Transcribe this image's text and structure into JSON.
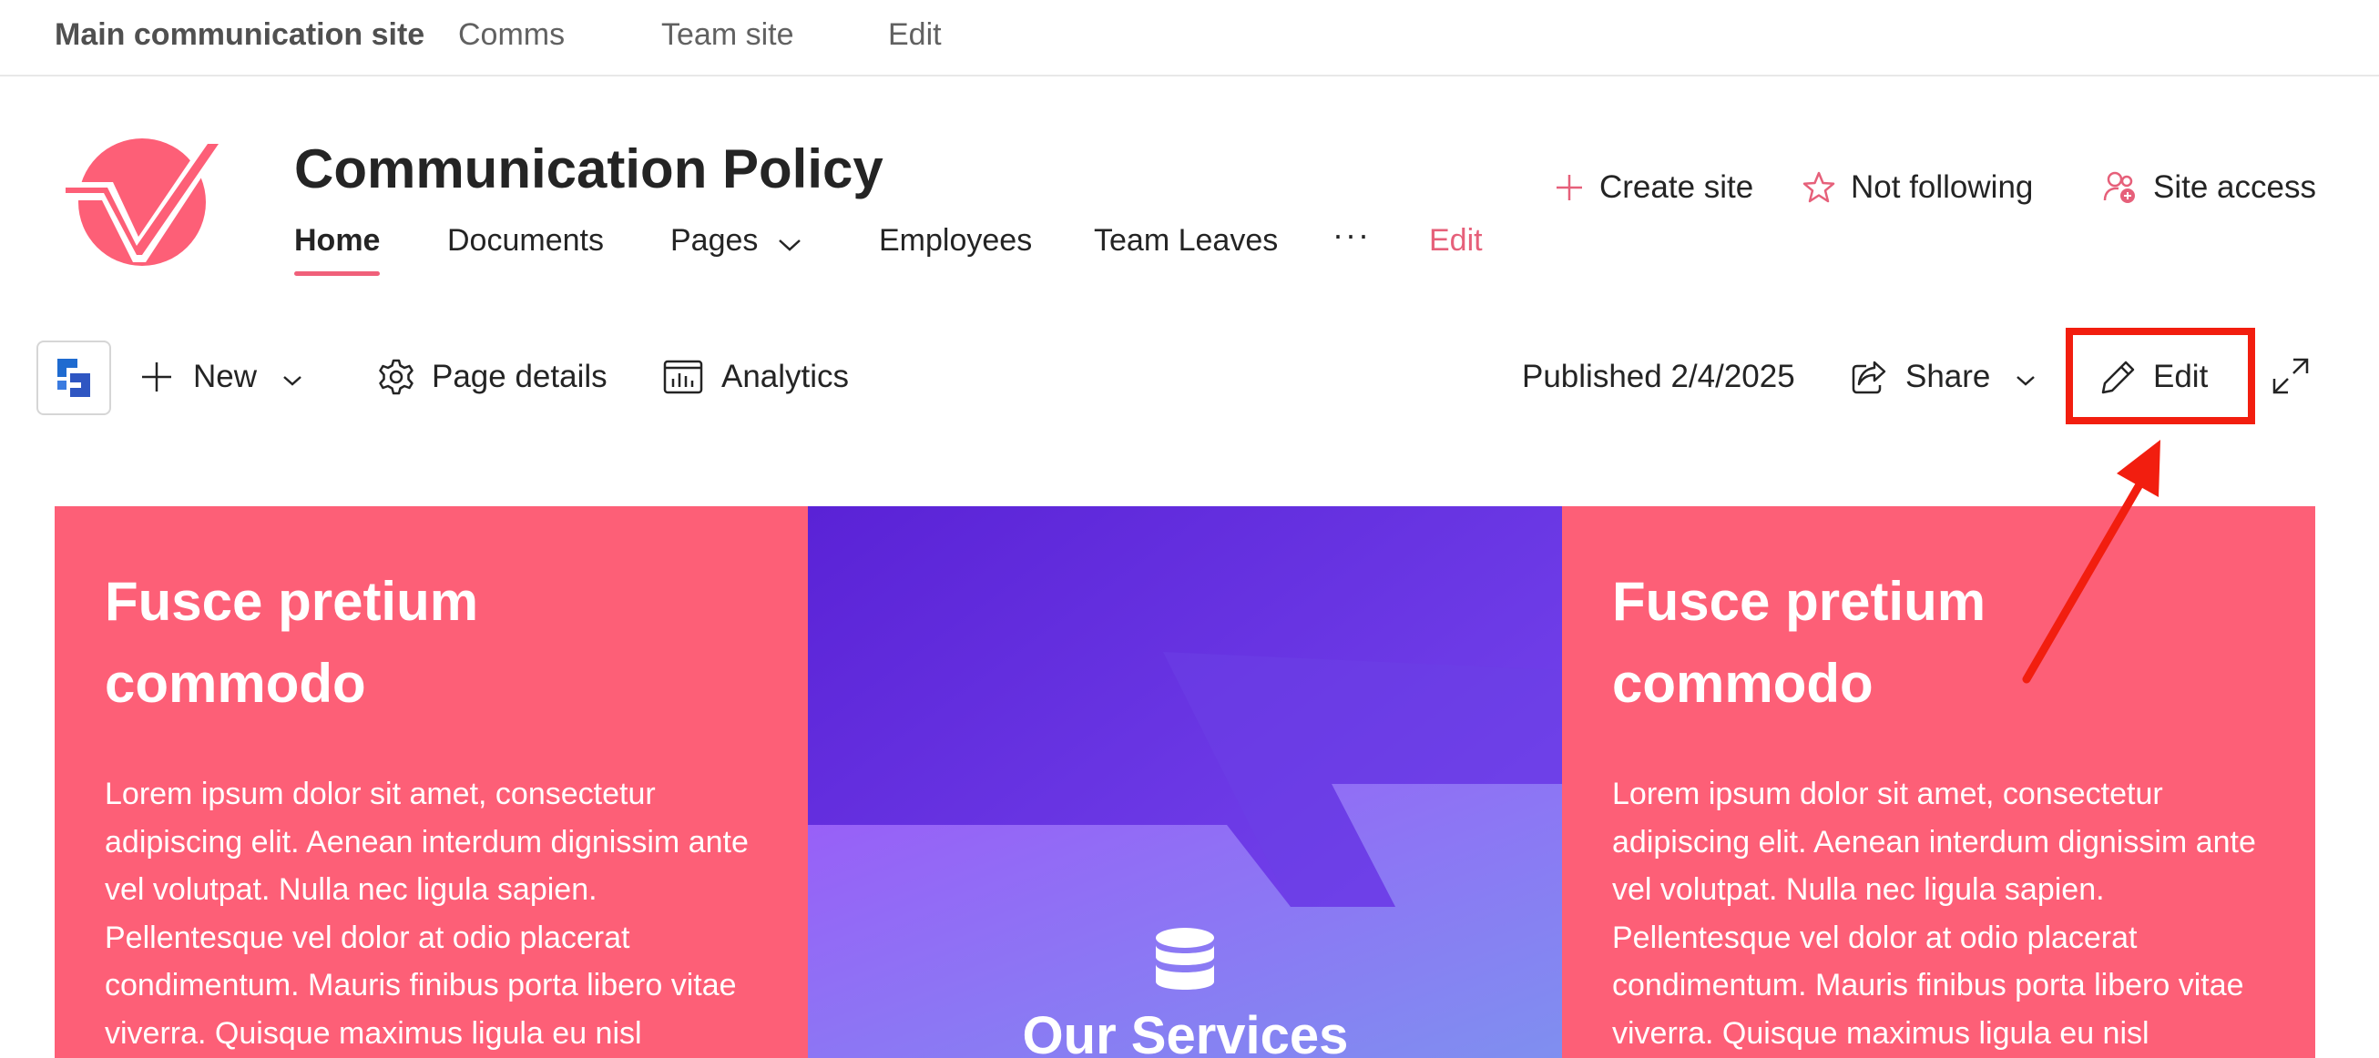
{
  "hub_nav": {
    "home": "Main communication site",
    "items": [
      "Comms",
      "Team site",
      "Edit"
    ]
  },
  "site": {
    "title": "Communication Policy",
    "nav": [
      "Home",
      "Documents",
      "Pages",
      "Employees",
      "Team Leaves",
      "···",
      "Edit"
    ],
    "active_nav": "Home",
    "actions": {
      "create": "Create site",
      "follow": "Not following",
      "access": "Site access"
    }
  },
  "command_bar": {
    "new": "New",
    "page_details": "Page details",
    "analytics": "Analytics",
    "published": "Published 2/4/2025",
    "share": "Share",
    "edit": "Edit"
  },
  "hero": {
    "left": {
      "title": "Fusce pretium commodo",
      "body": "Lorem ipsum dolor sit amet, consectetur adipiscing elit. Aenean interdum dignissim ante vel volutpat. Nulla nec ligula sapien. Pellentesque vel dolor at odio placerat condimentum. Mauris finibus porta libero vitae viverra. Quisque maximus ligula eu nisl"
    },
    "middle": {
      "title": "Our Services",
      "icon": "database-icon"
    },
    "right": {
      "title": "Fusce pretium commodo",
      "body": "Lorem ipsum dolor sit amet, consectetur adipiscing elit. Aenean interdum dignissim ante vel volutpat. Nulla nec ligula sapien. Pellentesque vel dolor at odio placerat condimentum. Mauris finibus porta libero vitae viverra. Quisque maximus ligula eu nisl"
    }
  },
  "colors": {
    "brand": "#fd5f77",
    "accent_text": "#e6607a",
    "purple_tile": "#6d3af0",
    "annotation": "#f21e0f"
  }
}
